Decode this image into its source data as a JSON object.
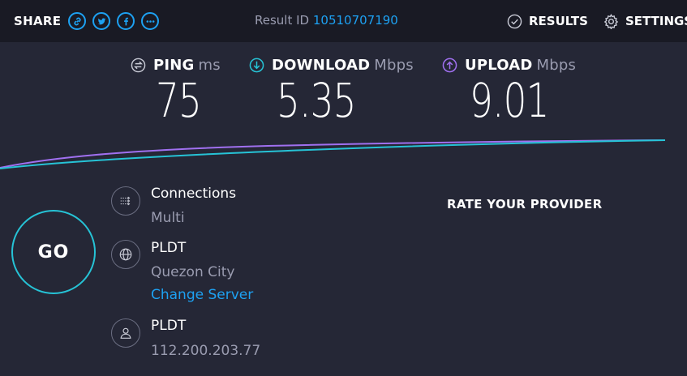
{
  "topbar": {
    "share_label": "SHARE",
    "share_buttons": [
      "link-icon",
      "twitter-icon",
      "facebook-icon",
      "more-icon"
    ],
    "result_id_label": "Result ID",
    "result_id_value": "10510707190",
    "results_label": "RESULTS",
    "settings_label": "SETTINGS"
  },
  "metrics": {
    "ping": {
      "label": "PING",
      "unit": "ms",
      "value": "75"
    },
    "download": {
      "label": "DOWNLOAD",
      "unit": "Mbps",
      "value": "5.35"
    },
    "upload": {
      "label": "UPLOAD",
      "unit": "Mbps",
      "value": "9.01"
    }
  },
  "go_label": "GO",
  "connections": {
    "title": "Connections",
    "value": "Multi"
  },
  "server": {
    "provider": "PLDT",
    "location": "Quezon City",
    "change_label": "Change Server"
  },
  "client": {
    "provider": "PLDT",
    "ip": "112.200.203.77"
  },
  "rate_provider_label": "RATE YOUR PROVIDER",
  "colors": {
    "accent": "#1da1f2",
    "download": "#26c3d6",
    "upload": "#a070f0",
    "background": "#252736"
  }
}
